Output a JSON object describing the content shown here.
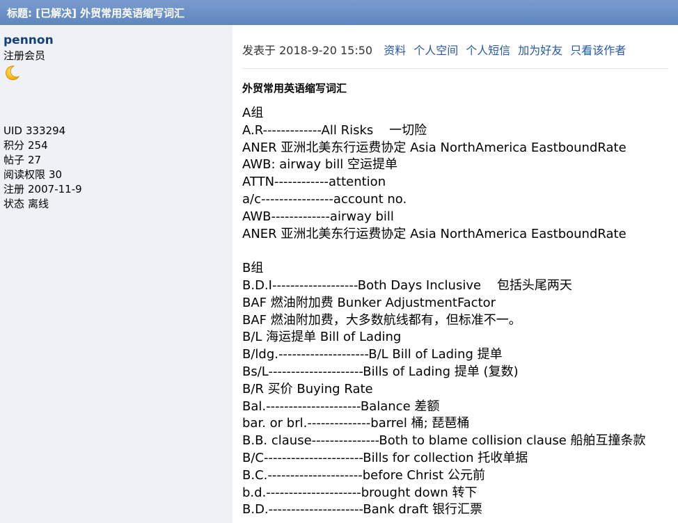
{
  "thread": {
    "title": "标题: [已解决] 外贸常用英语缩写词汇"
  },
  "user": {
    "name": "pennon",
    "role": "注册会员",
    "status_icon": "moon-icon",
    "stats": [
      {
        "label": "UID",
        "value": "333294"
      },
      {
        "label": "积分",
        "value": "254"
      },
      {
        "label": "帖子",
        "value": "27"
      },
      {
        "label": "阅读权限",
        "value": "30"
      },
      {
        "label": "注册",
        "value": "2007-11-9"
      },
      {
        "label": "状态",
        "value": "离线"
      }
    ]
  },
  "post": {
    "posted_at": "发表于 2018-9-20 15:50",
    "links": [
      "资料",
      "个人空间",
      "个人短信",
      "加为好友",
      "只看该作者"
    ],
    "title": "外贸常用英语缩写词汇",
    "lines": [
      "A组",
      "A.R-------------All Risks    一切险",
      "ANER 亚洲北美东行运费协定 Asia NorthAmerica EastboundRate",
      "AWB: airway bill 空运提单",
      "ATTN------------attention",
      "a/c----------------account no.",
      "AWB-------------airway bill",
      "ANER 亚洲北美东行运费协定 Asia NorthAmerica EastboundRate",
      "",
      "B组",
      "B.D.I-------------------Both Days Inclusive    包括头尾两天",
      "BAF 燃油附加费 Bunker AdjustmentFactor",
      "BAF 燃油附加费，大多数航线都有，但标准不一。",
      "B/L 海运提单 Bill of Lading",
      "B/ldg.--------------------B/L Bill of Lading 提单",
      "Bs/L---------------------Bills of Lading 提单 (复数)",
      "B/R 买价 Buying Rate",
      "Bal.---------------------Balance 差额",
      "bar. or brl.--------------barrel 桶; 琵琶桶",
      "B.B. clause---------------Both to blame collision clause 船舶互撞条款",
      "B/C----------------------Bills for collection 托收单据",
      "B.C.---------------------before Christ 公元前",
      "b.d.---------------------brought down 转下",
      "B.D.---------------------Bank draft 银行汇票"
    ]
  }
}
